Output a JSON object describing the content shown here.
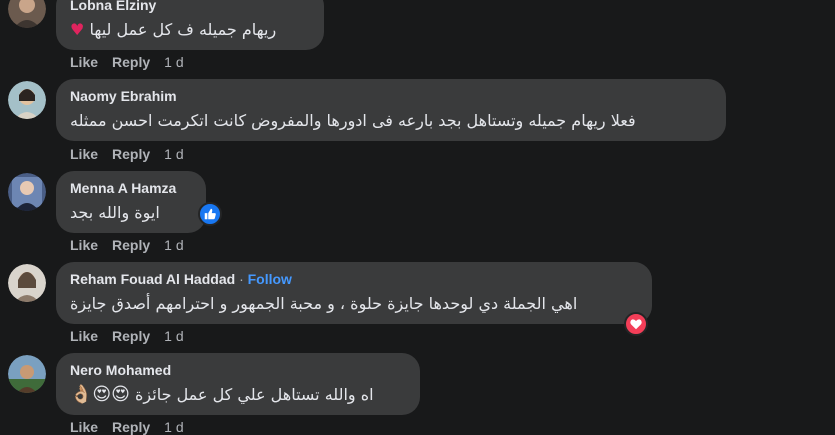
{
  "actions": {
    "like": "Like",
    "reply": "Reply"
  },
  "comments": [
    {
      "author": "Lobna Elziny",
      "text": "ريهام جميله ف كل عمل ليها",
      "emoji": "♥",
      "time": "1 d"
    },
    {
      "author": "Naomy Ebrahim",
      "text": "فعلا ريهام جميله وتستاهل بجد بارعه فى ادورها والمفروض كانت اتكرمت احسن ممثله",
      "time": "1 d"
    },
    {
      "author": "Menna A Hamza",
      "text": "ايوة والله بجد",
      "reaction": "like-reaction",
      "time": "1 d"
    },
    {
      "author": "Reham Fouad Al Haddad",
      "follow": "Follow",
      "text": "اهي الجملة دي لوحدها جايزة حلوة ، و محبة الجمهور و احترامهم أصدق جايزة",
      "reaction": "love-reaction",
      "time": "1 d"
    },
    {
      "author": "Nero Mohamed",
      "text": "اه والله تستاهل علي كل عمل جائزة",
      "emoji": "😍😍👌🏼",
      "time": "1 d"
    }
  ],
  "colors": {
    "background": "#18191a",
    "bubble": "#3a3b3c",
    "link": "#4599ff",
    "like": "#1877f2",
    "love": "#f33e58"
  }
}
